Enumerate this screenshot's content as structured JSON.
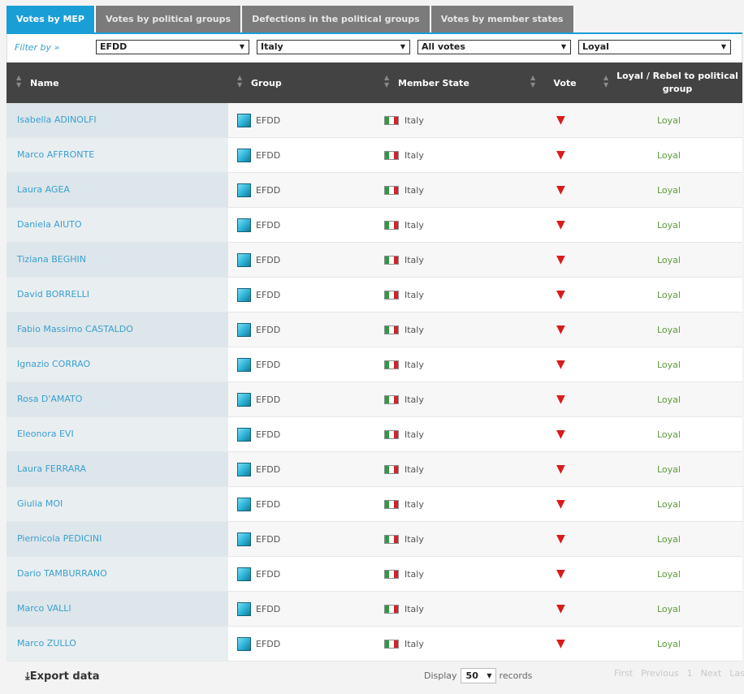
{
  "tabs": [
    "Votes by MEP",
    "Votes by political groups",
    "Defections in the political groups",
    "Votes by member states"
  ],
  "filter": {
    "label": "Filter by »",
    "group": "EFDD",
    "country": "Italy",
    "vote": "All votes",
    "loyalty": "Loyal"
  },
  "columns": {
    "name": "Name",
    "group": "Group",
    "member_state": "Member State",
    "vote": "Vote",
    "loyalty": "Loyal / Rebel to political group"
  },
  "rows": [
    {
      "name": "Isabella ADINOLFI",
      "group": "EFDD",
      "state": "Italy",
      "loyalty": "Loyal"
    },
    {
      "name": "Marco AFFRONTE",
      "group": "EFDD",
      "state": "Italy",
      "loyalty": "Loyal"
    },
    {
      "name": "Laura AGEA",
      "group": "EFDD",
      "state": "Italy",
      "loyalty": "Loyal"
    },
    {
      "name": "Daniela AIUTO",
      "group": "EFDD",
      "state": "Italy",
      "loyalty": "Loyal"
    },
    {
      "name": "Tiziana BEGHIN",
      "group": "EFDD",
      "state": "Italy",
      "loyalty": "Loyal"
    },
    {
      "name": "David BORRELLI",
      "group": "EFDD",
      "state": "Italy",
      "loyalty": "Loyal"
    },
    {
      "name": "Fabio Massimo CASTALDO",
      "group": "EFDD",
      "state": "Italy",
      "loyalty": "Loyal"
    },
    {
      "name": "Ignazio CORRAO",
      "group": "EFDD",
      "state": "Italy",
      "loyalty": "Loyal"
    },
    {
      "name": "Rosa D'AMATO",
      "group": "EFDD",
      "state": "Italy",
      "loyalty": "Loyal"
    },
    {
      "name": "Eleonora EVI",
      "group": "EFDD",
      "state": "Italy",
      "loyalty": "Loyal"
    },
    {
      "name": "Laura FERRARA",
      "group": "EFDD",
      "state": "Italy",
      "loyalty": "Loyal"
    },
    {
      "name": "Giulia MOI",
      "group": "EFDD",
      "state": "Italy",
      "loyalty": "Loyal"
    },
    {
      "name": "Piernicola PEDICINI",
      "group": "EFDD",
      "state": "Italy",
      "loyalty": "Loyal"
    },
    {
      "name": "Dario TAMBURRANO",
      "group": "EFDD",
      "state": "Italy",
      "loyalty": "Loyal"
    },
    {
      "name": "Marco VALLI",
      "group": "EFDD",
      "state": "Italy",
      "loyalty": "Loyal"
    },
    {
      "name": "Marco ZULLO",
      "group": "EFDD",
      "state": "Italy",
      "loyalty": "Loyal"
    }
  ],
  "vote_icon": "thumbs-down-icon",
  "footer": {
    "export": "Export data",
    "display": "Display",
    "records_value": "50",
    "records": "records",
    "pager": [
      "First",
      "Previous",
      "1",
      "Next",
      "Last"
    ]
  },
  "colors": {
    "accent": "#1a9ed6",
    "loyal": "#5c9a3a",
    "vote_against": "#d91b1b"
  }
}
